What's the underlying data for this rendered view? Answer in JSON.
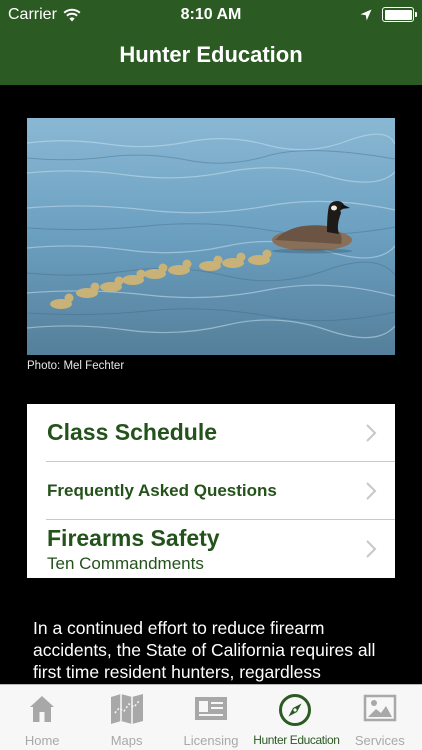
{
  "status_bar": {
    "carrier": "Carrier",
    "time": "8:10 AM",
    "icons": [
      "wifi-icon",
      "location-arrow-icon",
      "battery-icon"
    ]
  },
  "nav": {
    "title": "Hunter Education"
  },
  "photo": {
    "credit": "Photo: Mel Fechter"
  },
  "menu": {
    "items": [
      {
        "title": "Class Schedule"
      },
      {
        "title": "Frequently Asked Questions"
      },
      {
        "title": "Firearms Safety",
        "subtitle": "Ten Commandments"
      }
    ]
  },
  "description": "In a continued effort to reduce firearm accidents, the State of California requires all first time resident hunters, regardless",
  "tabbar": {
    "active_color": "#2b5a23",
    "inactive_color": "#a8a8a8",
    "tabs": [
      {
        "label": "Home",
        "icon": "house-icon"
      },
      {
        "label": "Maps",
        "icon": "map-icon"
      },
      {
        "label": "Licensing",
        "icon": "license-card-icon"
      },
      {
        "label": "Hunter Education",
        "icon": "compass-icon",
        "active": true
      },
      {
        "label": "Services",
        "icon": "picture-icon"
      }
    ]
  }
}
